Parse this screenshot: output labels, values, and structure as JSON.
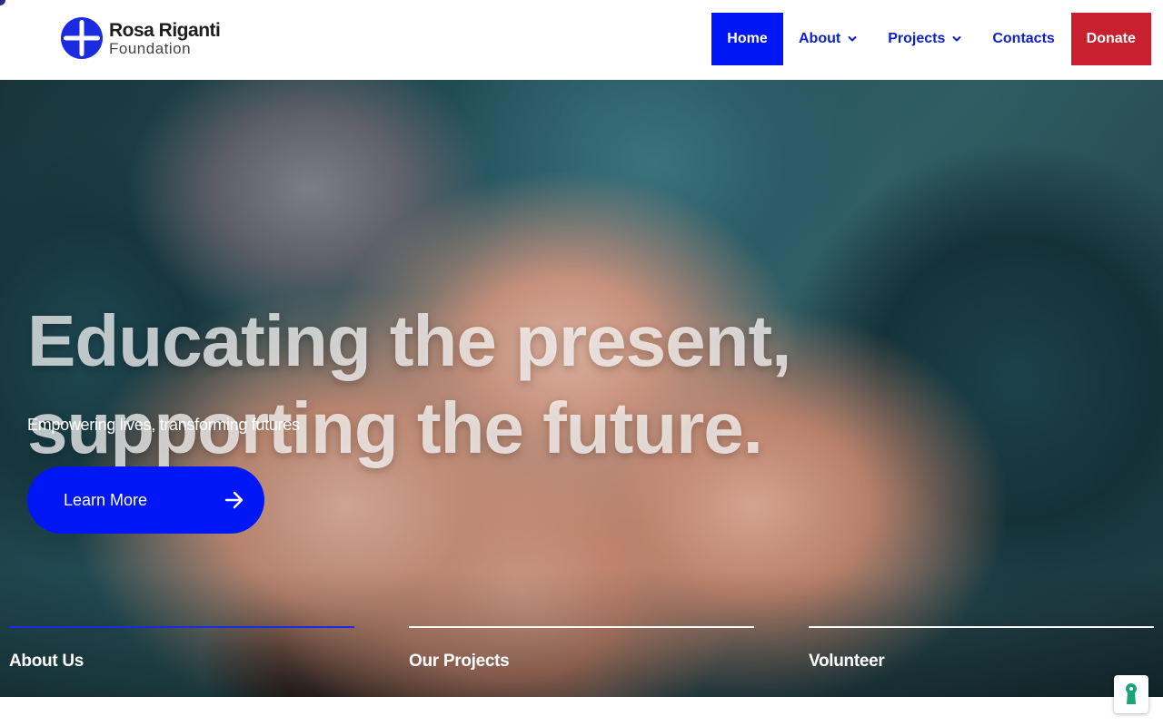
{
  "brand": {
    "name": "Rosa Riganti",
    "subtitle": "Foundation",
    "logo_color": "#1a2be0",
    "logo_icon": "cross-circle-logo"
  },
  "nav": {
    "items": [
      {
        "label": "Home",
        "active": true
      },
      {
        "label": "About",
        "has_dropdown": true
      },
      {
        "label": "Projects",
        "has_dropdown": true
      },
      {
        "label": "Contacts"
      },
      {
        "label": "Donate"
      }
    ],
    "accent_color": "#0017f5",
    "donate_color": "#c8202f"
  },
  "hero": {
    "headline_line1": "Educating the present,",
    "headline_line2": "supporting the future.",
    "tagline": "Empowering lives, transforming futures",
    "cta_label": "Learn More",
    "cta_icon": "arrow-right-icon"
  },
  "quick_links": [
    {
      "label": "About Us",
      "active": true
    },
    {
      "label": "Our Projects"
    },
    {
      "label": "Volunteer"
    }
  ],
  "accessibility": {
    "icon": "keyhole-accessibility-icon",
    "color": "#1ba37a"
  }
}
